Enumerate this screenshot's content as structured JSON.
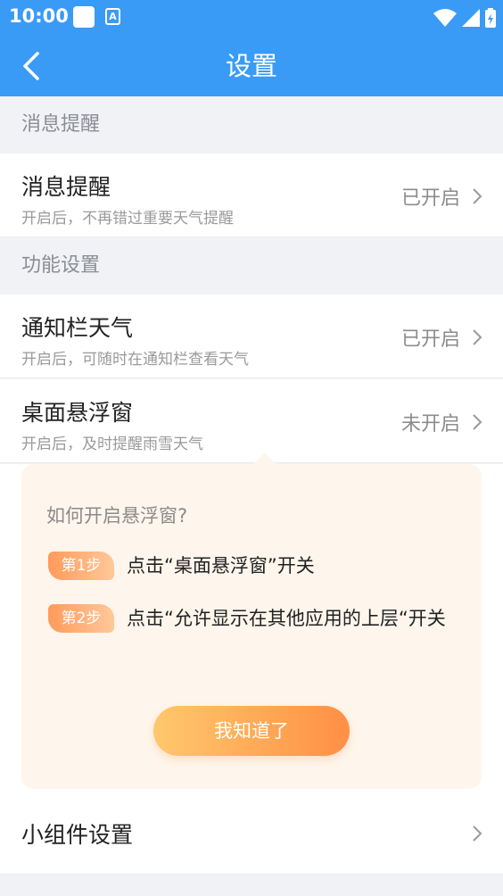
{
  "statusbar": {
    "time": "10:00",
    "badge": "A"
  },
  "appbar": {
    "title": "设置"
  },
  "sections": {
    "messages": {
      "header": "消息提醒"
    },
    "features": {
      "header": "功能设置"
    }
  },
  "rows": {
    "message_reminder": {
      "name": "消息提醒",
      "desc": "开启后，不再错过重要天气提醒",
      "status": "已开启"
    },
    "notification_weather": {
      "name": "通知栏天气",
      "desc": "开启后，可随时在通知栏查看天气",
      "status": "已开启"
    },
    "floating_window": {
      "name": "桌面悬浮窗",
      "desc": "开启后，及时提醒雨雪天气",
      "status": "未开启"
    },
    "widget_settings": {
      "name": "小组件设置"
    }
  },
  "tip": {
    "title": "如何开启悬浮窗?",
    "steps": [
      {
        "badge": "第1步",
        "text": "点击“桌面悬浮窗”开关"
      },
      {
        "badge": "第2步",
        "text": "点击“允许显示在其他应用的上层“开关"
      }
    ],
    "button": "我知道了"
  },
  "colors": {
    "primary": "#3a9bf6",
    "accent": "#ff8f45",
    "tip_bg": "#fef6ec"
  }
}
